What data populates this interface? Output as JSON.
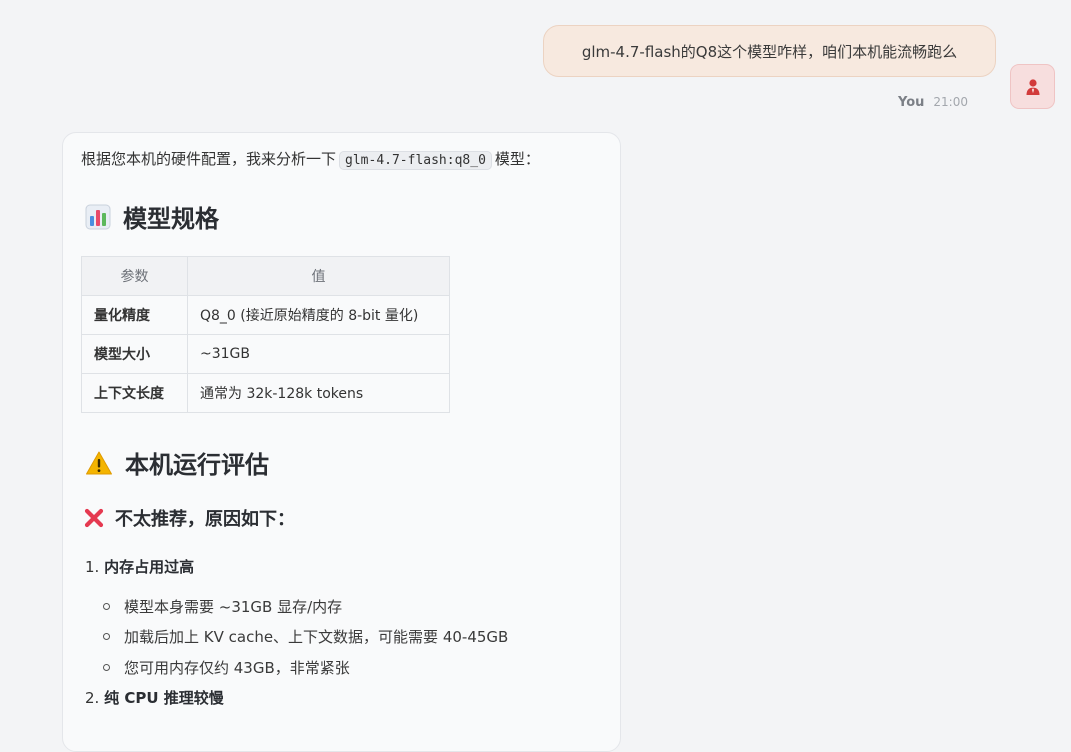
{
  "user": {
    "message": "glm-4.7-flash的Q8这个模型咋样，咱们本机能流畅跑么",
    "name": "You",
    "time": "21:00",
    "avatar_icon": "user-icon"
  },
  "assistant": {
    "intro_before": "根据您本机的硬件配置，我来分析一下",
    "intro_code": "glm-4.7-flash:q8_0",
    "intro_after": "模型：",
    "section1": {
      "icon": "bar-chart-icon",
      "title": "模型规格"
    },
    "table": {
      "headers": [
        "参数",
        "值"
      ],
      "rows": [
        {
          "key": "量化精度",
          "value": "Q8_0 (接近原始精度的 8-bit 量化)"
        },
        {
          "key": "模型大小",
          "value": "~31GB"
        },
        {
          "key": "上下文长度",
          "value": "通常为 32k-128k tokens"
        }
      ]
    },
    "section2": {
      "icon": "warning-icon",
      "title": "本机运行评估"
    },
    "section3": {
      "icon": "cross-mark-icon",
      "title": "不太推荐，原因如下："
    },
    "reasons": [
      {
        "number": "1.",
        "title": "内存占用过高",
        "points": [
          "模型本身需要 ~31GB 显存/内存",
          "加载后加上 KV cache、上下文数据，可能需要 40-45GB",
          "您可用内存仅约 43GB，非常紧张"
        ]
      },
      {
        "number": "2.",
        "title": "纯 CPU 推理较慢",
        "points": []
      }
    ]
  },
  "colors": {
    "background": "#f3f4f6",
    "user_bubble": "#f7e9df",
    "avatar_bg": "#f7dede",
    "avatar_icon": "#d23b3b",
    "card_bg": "#f9fafb",
    "warning": "#f4b400",
    "cross": "#e53950"
  }
}
